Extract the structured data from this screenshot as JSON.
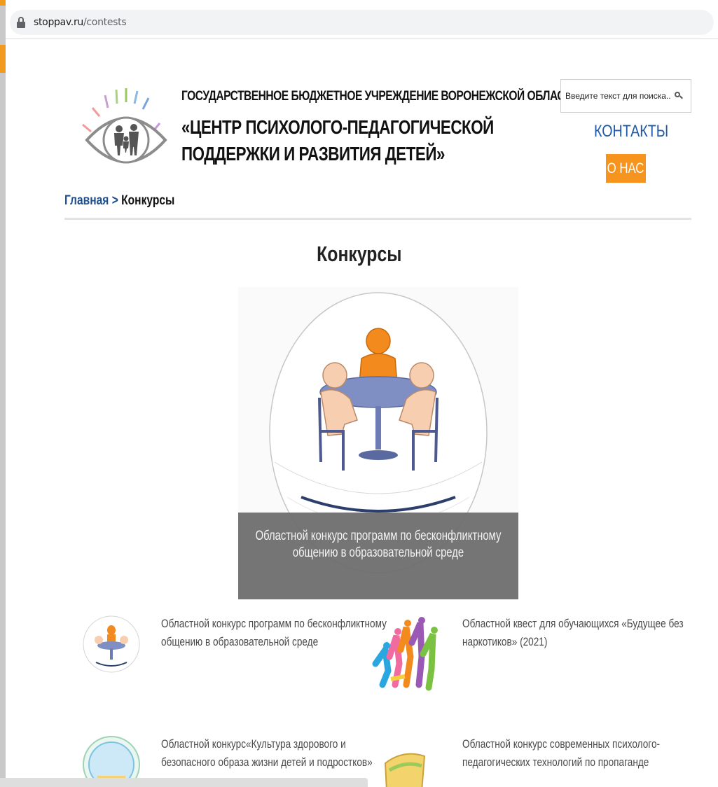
{
  "browser": {
    "url_host": "stoppav.ru",
    "url_path": "/contests"
  },
  "header": {
    "org_line1": "ГОСУДАРСТВЕННОЕ БЮДЖЕТНОЕ УЧРЕЖДЕНИЕ ВОРОНЕЖСКОЙ ОБЛАСТИ",
    "org_line2": "«ЦЕНТР ПСИХОЛОГО-ПЕДАГОГИЧЕСКОЙ",
    "org_line3": "ПОДДЕРЖКИ И РАЗВИТИЯ ДЕТЕЙ»",
    "search_placeholder": "Введите текст для поиска...",
    "contacts_label": "КОНТАКТЫ",
    "about_label": "О НАС"
  },
  "breadcrumb": {
    "home": "Главная",
    "separator": ">",
    "current": "Конкурсы"
  },
  "page": {
    "title": "Конкурсы"
  },
  "hero": {
    "caption": "Областной конкурс программ по бесконфликтному общению в образовательной среде"
  },
  "contests": [
    {
      "title": "Областной конкурс программ по бесконфликтному общению в образовательной среде",
      "icon": "round-table-icon"
    },
    {
      "title": "Областной квест для обучающихся «Будущее без наркотиков» (2021)",
      "icon": "dancing-people-icon"
    },
    {
      "title": "Областной конкурс«Культура здорового и безопасного образа жизни детей и подростков»",
      "icon": "emblem-icon"
    },
    {
      "title": "Областной конкурс современных психолого-педагогических технологий по пропаганде",
      "icon": "scroll-icon"
    }
  ],
  "colors": {
    "accent_orange": "#f7941d",
    "link_blue": "#1f5aa6",
    "breadcrumb_blue": "#1f4e8c",
    "caption_bg": "#6e6e6e"
  }
}
